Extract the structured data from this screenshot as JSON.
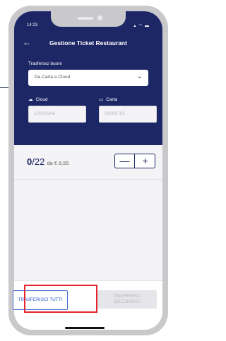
{
  "status_bar": {
    "time": "14:23",
    "icons": "▴ ◠ ▬"
  },
  "nav": {
    "back_icon": "←",
    "title": "Gestione Ticket Restaurant"
  },
  "transfer": {
    "section_label": "Trasferisci buoni",
    "dropdown_value": "Da Carta a Cloud",
    "chevron": "⌄"
  },
  "cloud": {
    "icon": "☁",
    "label": "Cloud",
    "value": "C0000348"
  },
  "card": {
    "icon": "▭",
    "label": "Carta",
    "value": "00000705"
  },
  "counter": {
    "selected": "0",
    "total": "/22",
    "price": "da € 8,55"
  },
  "stepper": {
    "minus": "—",
    "plus": "+"
  },
  "buttons": {
    "transfer_all": "TRASFERISCI TUTTI",
    "transfer_selected": "TRASFERISCI SELEZIONATI"
  },
  "colors": {
    "header": "#1e2766",
    "highlight": "#e0262d",
    "accent": "#2f5bd3"
  }
}
